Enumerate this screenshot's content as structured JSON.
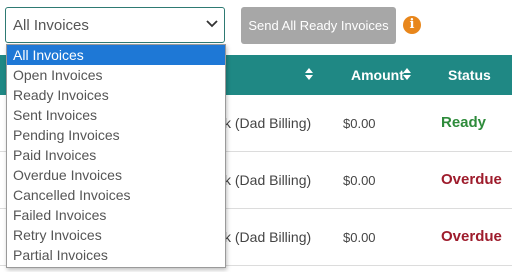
{
  "filter": {
    "selected": "All Invoices",
    "options": [
      "All Invoices",
      "Open Invoices",
      "Ready Invoices",
      "Sent Invoices",
      "Pending Invoices",
      "Paid Invoices",
      "Overdue Invoices",
      "Cancelled Invoices",
      "Failed Invoices",
      "Retry Invoices",
      "Partial Invoices"
    ]
  },
  "toolbar": {
    "send_label": "Send All Ready Invoices",
    "info_glyph": "i"
  },
  "table": {
    "columns": {
      "amount": "Amount",
      "status": "Status"
    },
    "rows": [
      {
        "name": "k (Dad Billing)",
        "amount": "$0.00",
        "status": "Ready"
      },
      {
        "name": "k (Dad Billing)",
        "amount": "$0.00",
        "status": "Overdue"
      },
      {
        "name": "k (Dad Billing)",
        "amount": "$0.00",
        "status": "Overdue"
      }
    ]
  },
  "colors": {
    "header_bg": "#1f8884",
    "ready": "#2e8b3b",
    "overdue": "#9e1c2c",
    "selected_option": "#1e78d6",
    "info": "#e8861b"
  }
}
